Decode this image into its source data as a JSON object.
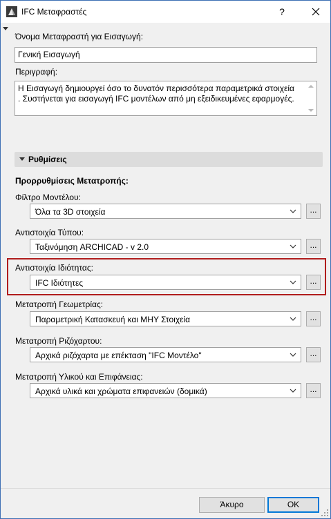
{
  "window": {
    "title": "IFC Μεταφραστές",
    "help_label": "?"
  },
  "translator": {
    "name_label": "Όνομα Μεταφραστή για Εισαγωγή:",
    "name_value": "Γενική Εισαγωγή",
    "description_label": "Περιγραφή:",
    "description_value": "Η Εισαγωγή δημιουργεί όσο το δυνατόν περισσότερα παραμετρικά στοιχεία . Συστήνεται για εισαγωγή IFC μοντέλων από μη εξειδικευμένες εφαρμογές."
  },
  "settings": {
    "header": "Ρυθμίσεις",
    "presets_label": "Προρρυθμίσεις Μετατροπής:",
    "rows": [
      {
        "label": "Φίλτρο Μοντέλου:",
        "value": "Όλα τα 3D στοιχεία",
        "button": "..."
      },
      {
        "label": "Αντιστοιχία Τύπου:",
        "value": "Ταξινόμηση ARCHICAD - v 2.0",
        "button": "..."
      },
      {
        "label": "Αντιστοιχία Ιδιότητας:",
        "value": "IFC Ιδιότητες",
        "button": "..."
      },
      {
        "label": "Μετατροπή Γεωμετρίας:",
        "value": "Παραμετρική Κατασκευή και ΜΗΥ Στοιχεία",
        "button": "..."
      },
      {
        "label": "Μετατροπή Ριζόχαρτου:",
        "value": "Αρχικά ριζόχαρτα με επέκταση \"IFC Μοντέλο\"",
        "button": "..."
      },
      {
        "label": "Μετατροπή Υλικού και Επιφάνειας:",
        "value": "Αρχικά υλικά και χρώματα επιφανειών (δομικά)",
        "button": "..."
      }
    ]
  },
  "footer": {
    "cancel_label": "Άκυρο",
    "ok_label": "OK"
  },
  "colors": {
    "highlight": "#b01c1c",
    "accent": "#0078d7"
  }
}
